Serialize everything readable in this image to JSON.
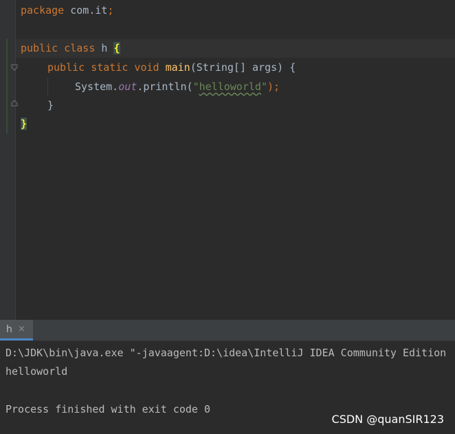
{
  "editor": {
    "line1": {
      "kw": "package",
      "name": "com.it",
      "semi": ";"
    },
    "line3": {
      "kw1": "public",
      "kw2": "class",
      "name": "h",
      "brace": "{"
    },
    "line4": {
      "mods": "public static void",
      "method": "main",
      "params": "(String[] args) {"
    },
    "line5": {
      "prefix": "System.",
      "field": "out",
      "call": ".println(",
      "quote_open": "\"",
      "string": "helloworld",
      "quote_close": "\"",
      "end": ");"
    },
    "line6": {
      "text": "}"
    },
    "line7": {
      "brace": "}"
    }
  },
  "run_panel": {
    "tab_label": "h",
    "close_label": "×"
  },
  "console": {
    "command": "D:\\JDK\\bin\\java.exe \"-javaagent:D:\\idea\\IntelliJ IDEA Community Edition",
    "output": "helloworld",
    "exit": "Process finished with exit code 0"
  },
  "watermark": "CSDN @quanSIR123"
}
